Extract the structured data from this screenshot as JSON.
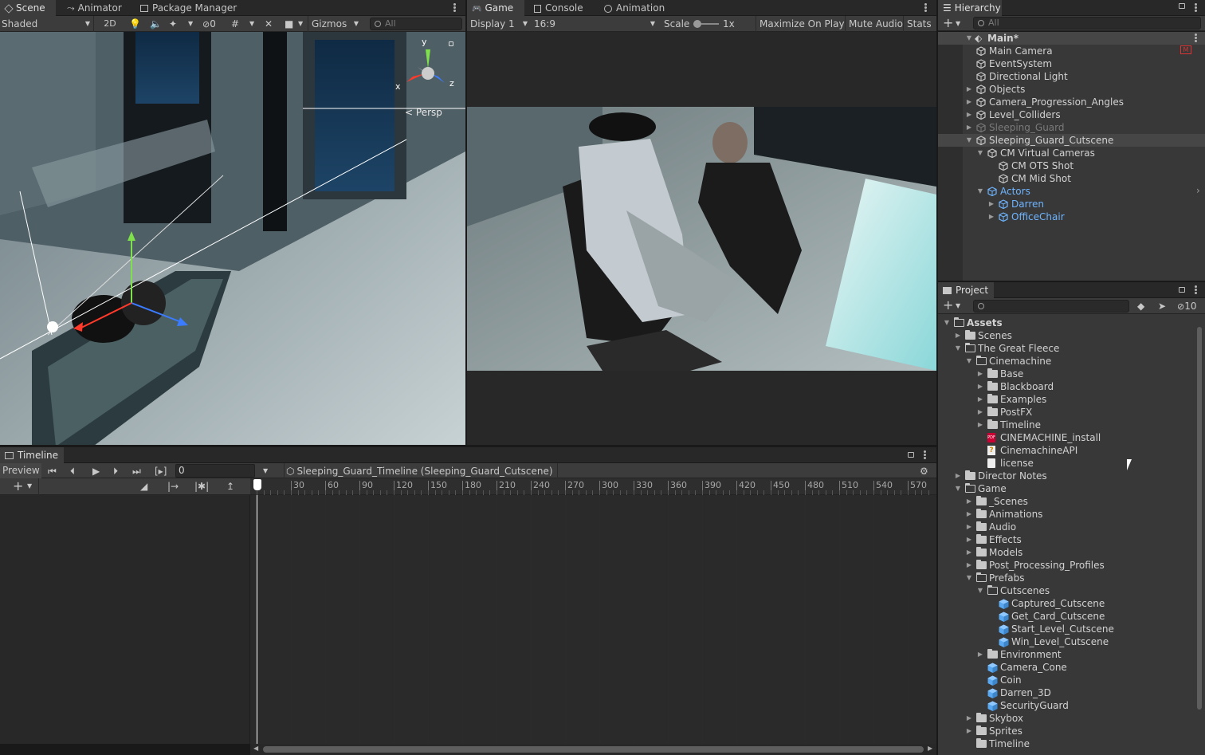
{
  "scene_tabs": {
    "scene": "Scene",
    "animator": "Animator",
    "package_manager": "Package Manager"
  },
  "scene_toolbar": {
    "shading": "Shaded",
    "mode_2d": "2D",
    "hidden_count": "0",
    "gizmos": "Gizmos",
    "search_placeholder": "All"
  },
  "scene_view": {
    "gizmo_y": "y",
    "gizmo_x": "x",
    "gizmo_z": "z",
    "projection": "Persp"
  },
  "game_tabs": {
    "game": "Game",
    "console": "Console",
    "animation": "Animation"
  },
  "game_toolbar": {
    "display": "Display 1",
    "aspect": "16:9",
    "scale_label": "Scale",
    "scale_value": "1x",
    "maximize": "Maximize On Play",
    "mute": "Mute Audio",
    "stats": "Stats"
  },
  "hierarchy": {
    "title": "Hierarchy",
    "search_placeholder": "All",
    "scene_name": "Main*",
    "items": [
      {
        "label": "Main Camera",
        "depth": 1,
        "arrow": "",
        "style": "normal"
      },
      {
        "label": "EventSystem",
        "depth": 1,
        "arrow": "",
        "style": "normal"
      },
      {
        "label": "Directional Light",
        "depth": 1,
        "arrow": "",
        "style": "normal"
      },
      {
        "label": "Objects",
        "depth": 1,
        "arrow": "right",
        "style": "normal"
      },
      {
        "label": "Camera_Progression_Angles",
        "depth": 1,
        "arrow": "right",
        "style": "normal"
      },
      {
        "label": "Level_Colliders",
        "depth": 1,
        "arrow": "right",
        "style": "normal"
      },
      {
        "label": "Sleeping_Guard",
        "depth": 1,
        "arrow": "right",
        "style": "disabled"
      },
      {
        "label": "Sleeping_Guard_Cutscene",
        "depth": 1,
        "arrow": "down",
        "style": "selected"
      },
      {
        "label": "CM Virtual Cameras",
        "depth": 2,
        "arrow": "down",
        "style": "normal"
      },
      {
        "label": "CM OTS Shot",
        "depth": 3,
        "arrow": "",
        "style": "normal"
      },
      {
        "label": "CM Mid Shot",
        "depth": 3,
        "arrow": "",
        "style": "normal"
      },
      {
        "label": "Actors",
        "depth": 2,
        "arrow": "down",
        "style": "prefab"
      },
      {
        "label": "Darren",
        "depth": 3,
        "arrow": "right",
        "style": "prefab"
      },
      {
        "label": "OfficeChair",
        "depth": 3,
        "arrow": "right",
        "style": "prefab"
      }
    ]
  },
  "project": {
    "title": "Project",
    "hidden_count": "10",
    "items": [
      {
        "label": "Assets",
        "depth": 0,
        "arrow": "down",
        "icon": "folder-open",
        "bold": true
      },
      {
        "label": "Scenes",
        "depth": 1,
        "arrow": "right",
        "icon": "folder"
      },
      {
        "label": "The Great Fleece",
        "depth": 1,
        "arrow": "down",
        "icon": "folder-open"
      },
      {
        "label": "Cinemachine",
        "depth": 2,
        "arrow": "down",
        "icon": "folder-open"
      },
      {
        "label": "Base",
        "depth": 3,
        "arrow": "right",
        "icon": "folder"
      },
      {
        "label": "Blackboard",
        "depth": 3,
        "arrow": "right",
        "icon": "folder"
      },
      {
        "label": "Examples",
        "depth": 3,
        "arrow": "right",
        "icon": "folder"
      },
      {
        "label": "PostFX",
        "depth": 3,
        "arrow": "right",
        "icon": "folder"
      },
      {
        "label": "Timeline",
        "depth": 3,
        "arrow": "right",
        "icon": "folder"
      },
      {
        "label": "CINEMACHINE_install",
        "depth": 3,
        "arrow": "",
        "icon": "pdf"
      },
      {
        "label": "CinemachineAPI",
        "depth": 3,
        "arrow": "",
        "icon": "doc-q"
      },
      {
        "label": "license",
        "depth": 3,
        "arrow": "",
        "icon": "doc"
      },
      {
        "label": "Director Notes",
        "depth": 1,
        "arrow": "right",
        "icon": "folder"
      },
      {
        "label": "Game",
        "depth": 1,
        "arrow": "down",
        "icon": "folder-open"
      },
      {
        "label": "_Scenes",
        "depth": 2,
        "arrow": "right",
        "icon": "folder"
      },
      {
        "label": "Animations",
        "depth": 2,
        "arrow": "right",
        "icon": "folder"
      },
      {
        "label": "Audio",
        "depth": 2,
        "arrow": "right",
        "icon": "folder"
      },
      {
        "label": "Effects",
        "depth": 2,
        "arrow": "right",
        "icon": "folder"
      },
      {
        "label": "Models",
        "depth": 2,
        "arrow": "right",
        "icon": "folder"
      },
      {
        "label": "Post_Processing_Profiles",
        "depth": 2,
        "arrow": "right",
        "icon": "folder"
      },
      {
        "label": "Prefabs",
        "depth": 2,
        "arrow": "down",
        "icon": "folder-open"
      },
      {
        "label": "Cutscenes",
        "depth": 3,
        "arrow": "down",
        "icon": "folder-open"
      },
      {
        "label": "Captured_Cutscene",
        "depth": 4,
        "arrow": "",
        "icon": "prefab"
      },
      {
        "label": "Get_Card_Cutscene",
        "depth": 4,
        "arrow": "",
        "icon": "prefab"
      },
      {
        "label": "Start_Level_Cutscene",
        "depth": 4,
        "arrow": "",
        "icon": "prefab"
      },
      {
        "label": "Win_Level_Cutscene",
        "depth": 4,
        "arrow": "",
        "icon": "prefab"
      },
      {
        "label": "Environment",
        "depth": 3,
        "arrow": "right",
        "icon": "folder"
      },
      {
        "label": "Camera_Cone",
        "depth": 3,
        "arrow": "",
        "icon": "prefab"
      },
      {
        "label": "Coin",
        "depth": 3,
        "arrow": "",
        "icon": "prefab"
      },
      {
        "label": "Darren_3D",
        "depth": 3,
        "arrow": "",
        "icon": "prefab"
      },
      {
        "label": "SecurityGuard",
        "depth": 3,
        "arrow": "",
        "icon": "prefab"
      },
      {
        "label": "Skybox",
        "depth": 2,
        "arrow": "right",
        "icon": "folder"
      },
      {
        "label": "Sprites",
        "depth": 2,
        "arrow": "right",
        "icon": "folder"
      },
      {
        "label": "Timeline",
        "depth": 2,
        "arrow": "",
        "icon": "folder"
      }
    ]
  },
  "timeline": {
    "title": "Timeline",
    "preview": "Preview",
    "frame": "0",
    "asset": "Sleeping_Guard_Timeline (Sleeping_Guard_Cutscene)",
    "ruler": [
      "30",
      "60",
      "90",
      "120",
      "150",
      "180",
      "210",
      "240",
      "270",
      "300",
      "330",
      "360",
      "390",
      "420",
      "450",
      "480",
      "510",
      "540",
      "570"
    ]
  },
  "colors": {
    "accent_blue": "#2c5d87",
    "prefab_blue": "#6eb4ff",
    "panel": "#3c3c3c",
    "dark": "#282828"
  }
}
